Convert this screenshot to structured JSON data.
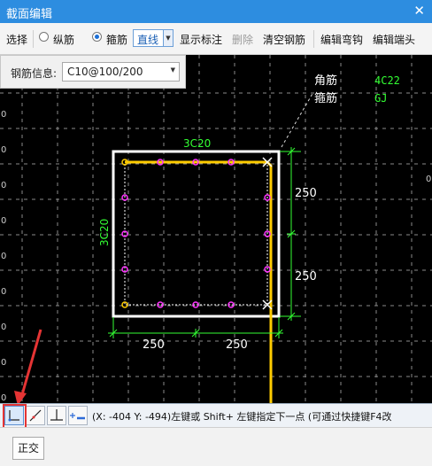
{
  "window": {
    "title": "截面编辑",
    "close_glyph": "✕"
  },
  "toolbar": {
    "select": "选择",
    "long_rebar": "纵筋",
    "stirrup": "箍筋",
    "line_mode": "直线",
    "show_labels": "显示标注",
    "delete": "删除",
    "clear_rebar": "清空钢筋",
    "edit_hook": "编辑弯钩",
    "edit_end": "编辑端头"
  },
  "rebar_info": {
    "label": "钢筋信息:",
    "value": "C10@100/200"
  },
  "drawing": {
    "corner_label": "角筋",
    "corner_value": "4C22",
    "stirrup_label": "箍筋",
    "stirrup_value": "GJ",
    "top_rebar": "3C20",
    "left_rebar": "3C20",
    "dim_right_top": "250",
    "dim_right_bottom": "250",
    "dim_bottom_left": "250",
    "dim_bottom_right": "250",
    "edge_ticks": [
      "0",
      "0",
      "0",
      "0",
      "0",
      "0",
      "0",
      "0",
      "0",
      "0"
    ]
  },
  "colors": {
    "background": "#000000",
    "grid": "#8a8a8a",
    "section_outline": "#ffffff",
    "stirrup_line": "#ffcc00",
    "dimension": "#33ff33",
    "rebar_point": "#ff33ff",
    "corner_label_text": "#ffffff",
    "value_text": "#33ff33",
    "annotation_arrow": "#e53434"
  },
  "statusbar": {
    "mode_icons": [
      "l-shape-icon",
      "oblique-line-icon",
      "perpendicular-icon",
      "offset-line-icon"
    ],
    "hint": "(X: -404 Y: -494)左键或 Shift+ 左键指定下一点 (可通过快捷键F4改"
  },
  "bottombar": {
    "ortho": "正交"
  }
}
